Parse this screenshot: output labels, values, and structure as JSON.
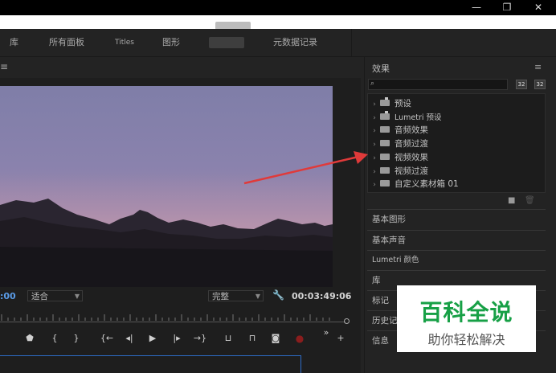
{
  "window": {
    "controls": [
      "—",
      "❐",
      "✕"
    ]
  },
  "workspace_tabs": [
    "库",
    "所有面板",
    "Titles",
    "图形",
    "元数据记录"
  ],
  "monitor": {
    "menu_icon": "hamburger-icon",
    "timecode_left": ":00",
    "fit_select": "适合",
    "quality_select": "完整",
    "timecode_right": "00:03:49:06",
    "controls": [
      "marker-icon",
      "in-point-icon",
      "out-point-icon",
      "go-to-in-icon",
      "step-back-icon",
      "play-icon",
      "step-forward-icon",
      "go-to-out-icon",
      "insert-icon",
      "overwrite-icon",
      "camera-icon",
      "record-icon",
      "more-icon",
      "add-icon"
    ],
    "control_glyphs": [
      "⬟",
      "{",
      "}",
      "{←",
      "◂|",
      "▶",
      "|▸",
      "→}",
      "⊔",
      "⊓",
      "◙",
      "●",
      "»",
      "+"
    ]
  },
  "effects": {
    "title": "效果",
    "menu_glyph": "≡",
    "search_placeholder": "",
    "search_glyph": "⌕",
    "buttons": [
      "32",
      "32"
    ],
    "tree": [
      {
        "label": "预设",
        "icon": "star-folder-icon"
      },
      {
        "label": "Lumetri 预设",
        "icon": "star-folder-icon"
      },
      {
        "label": "音频效果",
        "icon": "folder-icon"
      },
      {
        "label": "音频过渡",
        "icon": "folder-icon"
      },
      {
        "label": "视频效果",
        "icon": "folder-icon"
      },
      {
        "label": "视频过渡",
        "icon": "folder-icon"
      },
      {
        "label": "自定义素材箱 01",
        "icon": "folder-icon"
      }
    ],
    "footer_glyphs": [
      "■",
      "🗑"
    ]
  },
  "panels": [
    "基本图形",
    "基本声音",
    "Lumetri 颜色",
    "库",
    "标记",
    "历史记",
    "信息"
  ],
  "watermark": {
    "title": "百科全说",
    "subtitle": "助你轻松解决"
  },
  "colors": {
    "accent_blue": "#5a9ce8",
    "arrow_red": "#e03a3a",
    "watermark_green": "#17a046"
  }
}
